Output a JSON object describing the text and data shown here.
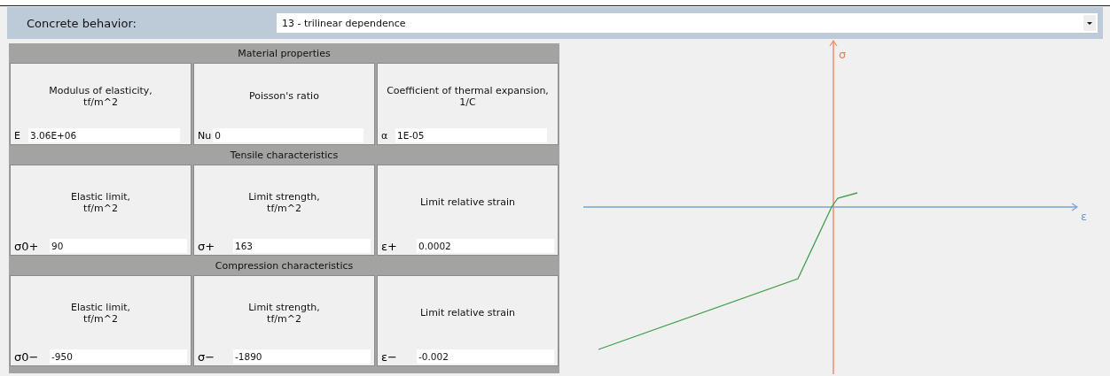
{
  "behavior": {
    "label": "Concrete behavior:",
    "value": "13 - trilinear dependence"
  },
  "sections": [
    {
      "title": "Material properties",
      "cells": [
        {
          "label": "Modulus of elasticity,\ntf/m^2",
          "symbol": "E",
          "value": "3.06E+06",
          "kind": "short"
        },
        {
          "label": "Poisson's ratio",
          "symbol": "Nu",
          "value": "0",
          "kind": "short"
        },
        {
          "label": "Coefficient of thermal expansion, 1/C",
          "symbol": "α",
          "value": "1E-05",
          "kind": "short"
        }
      ]
    },
    {
      "title": "Tensile characteristics",
      "cells": [
        {
          "label": "Elastic limit,\ntf/m^2",
          "symbol": "σ0+",
          "value": "90",
          "kind": "wide"
        },
        {
          "label": "Limit strength,\ntf/m^2",
          "symbol": "σ+",
          "value": "163",
          "kind": "wide"
        },
        {
          "label": "Limit relative strain",
          "symbol": "ε+",
          "value": "0.0002",
          "kind": "wide"
        }
      ]
    },
    {
      "title": "Compression characteristics",
      "cells": [
        {
          "label": "Elastic limit,\ntf/m^2",
          "symbol": "σ0−",
          "value": "-950",
          "kind": "wide"
        },
        {
          "label": "Limit strength,\ntf/m^2",
          "symbol": "σ−",
          "value": "-1890",
          "kind": "wide"
        },
        {
          "label": "Limit relative strain",
          "symbol": "ε−",
          "value": "-0.002",
          "kind": "wide"
        }
      ]
    }
  ],
  "diagram": {
    "y_axis_label": "σ",
    "x_axis_label": "ε"
  }
}
